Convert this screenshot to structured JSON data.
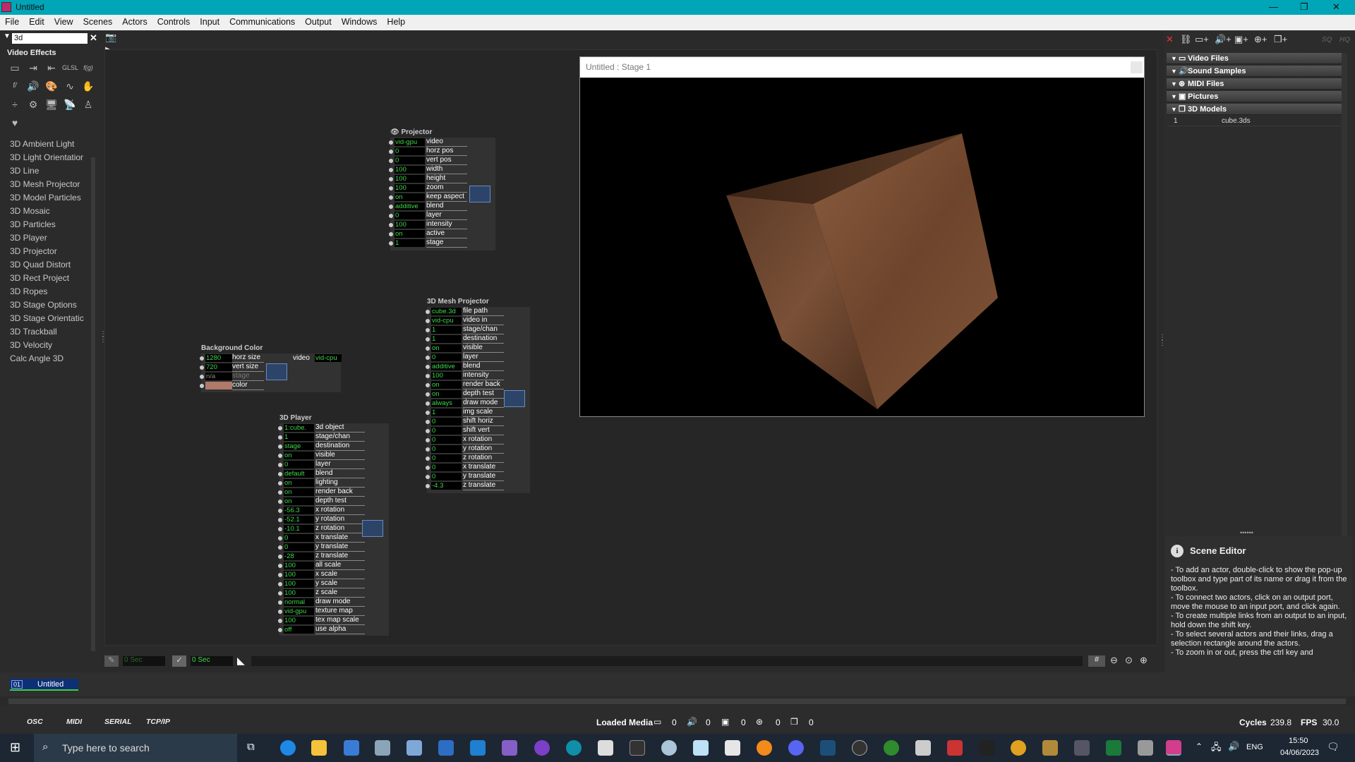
{
  "window": {
    "title": "Untitled"
  },
  "menu": [
    "File",
    "Edit",
    "View",
    "Scenes",
    "Actors",
    "Controls",
    "Input",
    "Communications",
    "Output",
    "Windows",
    "Help"
  ],
  "toolbox": {
    "search_value": "3d",
    "section_title": "Video Effects",
    "actors": [
      "3D Ambient Light",
      "3D Light Orientatior",
      "3D Line",
      "3D Mesh Projector",
      "3D Model Particles",
      "3D Mosaic",
      "3D Particles",
      "3D Player",
      "3D Projector",
      "3D Quad Distort",
      "3D Rect Project",
      "3D Ropes",
      "3D Stage Options",
      "3D Stage Orientatic",
      "3D Trackball",
      "3D Velocity",
      "Calc Angle 3D"
    ]
  },
  "actors": {
    "projector": {
      "title": "Projector",
      "rows": [
        [
          "vid-gpu",
          "video"
        ],
        [
          "0",
          "horz pos"
        ],
        [
          "0",
          "vert pos"
        ],
        [
          "100",
          "width"
        ],
        [
          "100",
          "height"
        ],
        [
          "100",
          "zoom"
        ],
        [
          "on",
          "keep aspect"
        ],
        [
          "additive",
          "blend"
        ],
        [
          "0",
          "layer"
        ],
        [
          "100",
          "intensity"
        ],
        [
          "on",
          "active"
        ],
        [
          "1",
          "stage"
        ]
      ]
    },
    "mesh": {
      "title": "3D Mesh Projector",
      "rows": [
        [
          "cube.3d",
          "file path"
        ],
        [
          "vid-cpu",
          "video in"
        ],
        [
          "1",
          "stage/chan"
        ],
        [
          "1",
          "destination"
        ],
        [
          "on",
          "visible"
        ],
        [
          "0",
          "layer"
        ],
        [
          "additive",
          "blend"
        ],
        [
          "100",
          "intensity"
        ],
        [
          "on",
          "render back"
        ],
        [
          "on",
          "depth test"
        ],
        [
          "always",
          "draw mode"
        ],
        [
          "1",
          "img scale"
        ],
        [
          "0",
          "shift horiz"
        ],
        [
          "0",
          "shift vert"
        ],
        [
          "0",
          "x rotation"
        ],
        [
          "0",
          "y rotation"
        ],
        [
          "0",
          "z rotation"
        ],
        [
          "0",
          "x translate"
        ],
        [
          "0",
          "y translate"
        ],
        [
          "-4.3",
          "z translate"
        ]
      ]
    },
    "bg": {
      "title": "Background Color",
      "rows": [
        [
          "1280",
          "horz size"
        ],
        [
          "720",
          "vert size"
        ],
        [
          "n/a",
          "stage"
        ],
        [
          "",
          "color"
        ]
      ],
      "out_label": "video",
      "out_value": "vid-cpu"
    },
    "player": {
      "title": "3D Player",
      "rows": [
        [
          "1:cube.",
          "3d object"
        ],
        [
          "1",
          "stage/chan"
        ],
        [
          "stage",
          "destination"
        ],
        [
          "on",
          "visible"
        ],
        [
          "0",
          "layer"
        ],
        [
          "default",
          "blend"
        ],
        [
          "on",
          "lighting"
        ],
        [
          "on",
          "render back"
        ],
        [
          "on",
          "depth test"
        ],
        [
          "-56.3",
          "x rotation"
        ],
        [
          "-52.1",
          "y rotation"
        ],
        [
          "-10.1",
          "z rotation"
        ],
        [
          "0",
          "x translate"
        ],
        [
          "0",
          "y translate"
        ],
        [
          "-28",
          "z translate"
        ],
        [
          "100",
          "all scale"
        ],
        [
          "100",
          "x scale"
        ],
        [
          "100",
          "y scale"
        ],
        [
          "100",
          "z scale"
        ],
        [
          "normal",
          "draw mode"
        ],
        [
          "vid-gpu",
          "texture map"
        ],
        [
          "100",
          "tex map scale"
        ],
        [
          "off",
          "use alpha"
        ]
      ]
    }
  },
  "stage": {
    "title": "Untitled : Stage 1"
  },
  "media": {
    "sections": [
      "Video Files",
      "Sound Samples",
      "MIDI Files",
      "Pictures",
      "3D Models"
    ],
    "model_index": "1",
    "model_name": "cube.3ds",
    "toolbar_sq": "SQ",
    "toolbar_hq": "HQ"
  },
  "scene_editor": {
    "title": "Scene Editor",
    "text": "- To add an actor, double-click to show the pop-up toolbox and type part of its name or drag it from the toolbox.\n- To connect two actors, click on an output port, move the mouse to an input port, and click again.\n- To create multiple links from an output to an input, hold down the shift key.\n- To select several actors and their links, drag a selection rectangle around the actors.\n- To zoom in or out, press the ctrl key and"
  },
  "timebar": {
    "time1": "0 Sec",
    "time2": "0 Sec",
    "grid": "#"
  },
  "scene_tab": {
    "number": "01",
    "name": "Untitled"
  },
  "status": {
    "buttons": [
      "OSC",
      "MIDI",
      "SERIAL",
      "TCP/IP"
    ],
    "loaded_media_label": "Loaded Media",
    "counts": [
      "0",
      "0",
      "0",
      "0",
      "0"
    ],
    "cycles_label": "Cycles",
    "cycles_value": "239.8",
    "fps_label": "FPS",
    "fps_value": "30.0"
  },
  "taskbar": {
    "search_placeholder": "Type here to search",
    "lang": "ENG",
    "time": "15:50",
    "date": "04/06/2023"
  },
  "colors": {
    "accent": "#00a6b8",
    "value_green": "#3fd94a",
    "bg_color_swatch": "#b07a6a"
  }
}
